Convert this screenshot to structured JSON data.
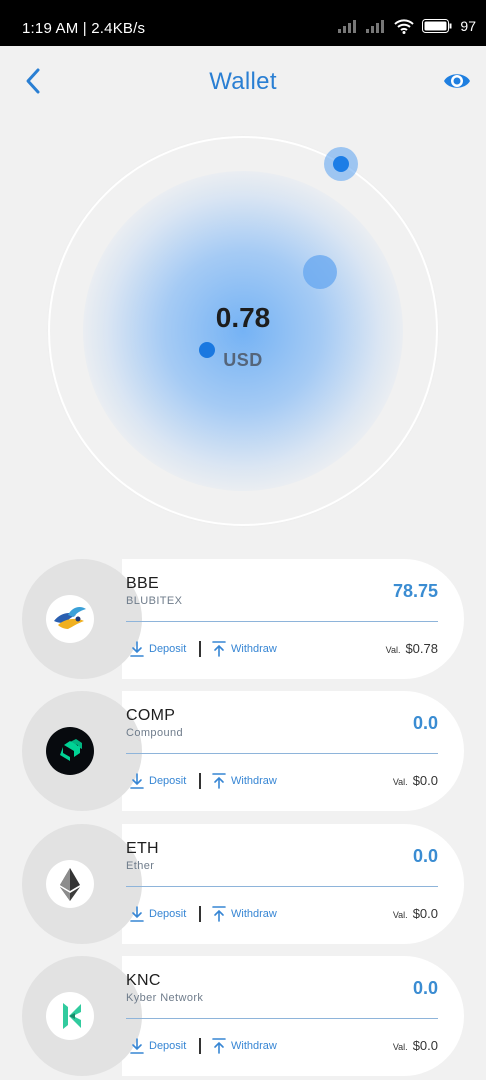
{
  "status_bar": {
    "time_speed": "1:19 AM | 2.4KB/s",
    "battery": "97"
  },
  "header": {
    "title": "Wallet"
  },
  "balance": {
    "value": "0.78",
    "currency": "USD"
  },
  "actions": {
    "deposit_label": "Deposit",
    "withdraw_label": "Withdraw",
    "val_label": "Val."
  },
  "tokens": [
    {
      "symbol": "BBE",
      "name": "BLUBITEX",
      "amount": "78.75",
      "value": "$0.78",
      "icon": "blubitex-bird-logo"
    },
    {
      "symbol": "COMP",
      "name": "Compound",
      "amount": "0.0",
      "value": "$0.0",
      "icon": "compound-logo"
    },
    {
      "symbol": "ETH",
      "name": "Ether",
      "amount": "0.0",
      "value": "$0.0",
      "icon": "ethereum-logo"
    },
    {
      "symbol": "KNC",
      "name": "Kyber Network",
      "amount": "0.0",
      "value": "$0.0",
      "icon": "kyber-logo"
    }
  ],
  "colors": {
    "accent": "#2a7fd3",
    "amount": "#3a8cd2",
    "background": "#f1f1f1"
  }
}
